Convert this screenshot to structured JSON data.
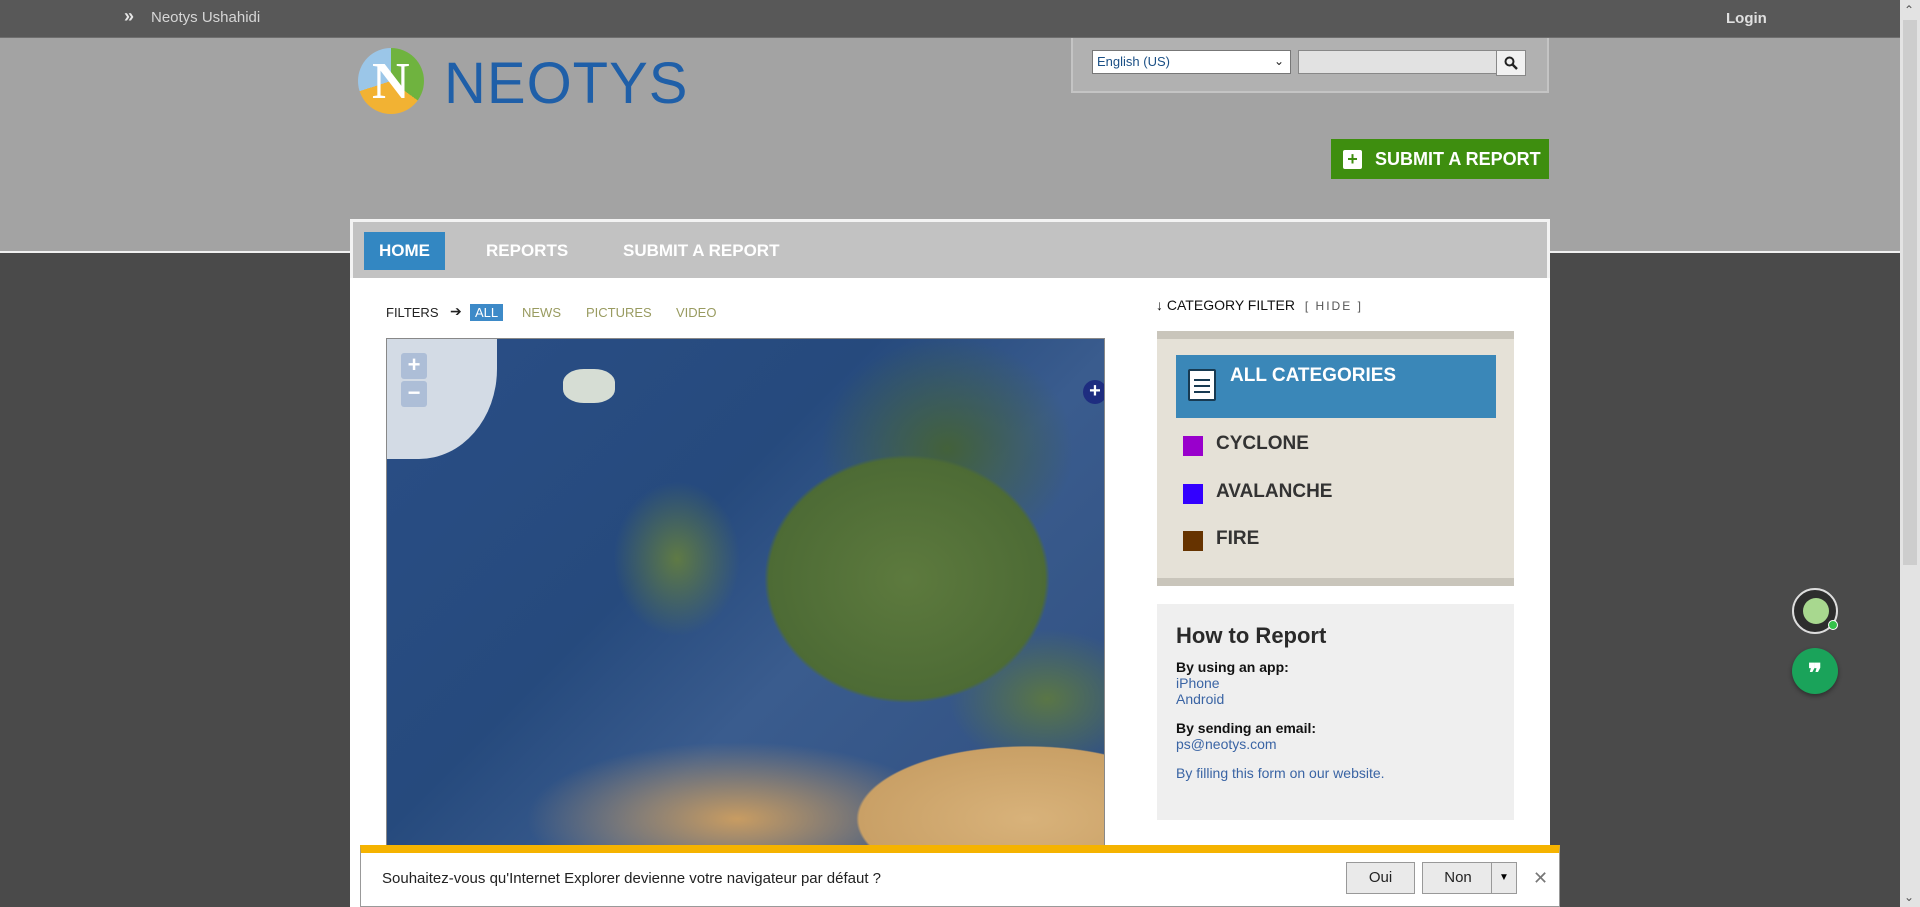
{
  "topbar": {
    "brand_arrows": "»",
    "brand": "Neotys Ushahidi",
    "login": "Login"
  },
  "header": {
    "logo_letter": "N",
    "logo_word": "NEOTYS",
    "language_selected": "English (US)",
    "language_chevron": "⌄",
    "search_placeholder": "",
    "search_icon": "search-icon",
    "submit_plus": "+",
    "submit_label": "SUBMIT A REPORT"
  },
  "nav": {
    "tabs": [
      {
        "label": "HOME",
        "active": true
      },
      {
        "label": "REPORTS",
        "active": false
      },
      {
        "label": "SUBMIT A REPORT",
        "active": false
      }
    ]
  },
  "filters": {
    "label": "FILTERS",
    "arrow": "➔",
    "items": [
      "ALL",
      "NEWS",
      "PICTURES",
      "VIDEO"
    ],
    "active": "ALL"
  },
  "map": {
    "zoom_in": "+",
    "zoom_out": "−",
    "layer_switcher": "+"
  },
  "category_filter": {
    "title": "↓ CATEGORY FILTER",
    "hide": "[ HIDE ]",
    "all_label": "ALL CATEGORIES",
    "categories": [
      {
        "name": "CYCLONE",
        "color": "#9900cc"
      },
      {
        "name": "AVALANCHE",
        "color": "#3300ff"
      },
      {
        "name": "FIRE",
        "color": "#663300"
      }
    ]
  },
  "how_to_report": {
    "title": "How to Report",
    "app_label": "By using an app:",
    "apps": [
      "iPhone",
      "Android"
    ],
    "email_label": "By sending an email:",
    "email": "ps@neotys.com",
    "form_link": "By filling this form on our website."
  },
  "chat": {
    "button_glyph": "❞"
  },
  "ie_bar": {
    "message": "Souhaitez-vous qu'Internet Explorer devienne votre navigateur par défaut ?",
    "yes": "Oui",
    "no": "Non",
    "dropdown": "▼",
    "close": "✕"
  },
  "scrollbar": {
    "up": "⌃",
    "down": "⌄"
  },
  "colors": {
    "accent_blue": "#3387c2",
    "submit_green": "#3e8e0f",
    "ie_bar_yellow": "#f5b300"
  }
}
